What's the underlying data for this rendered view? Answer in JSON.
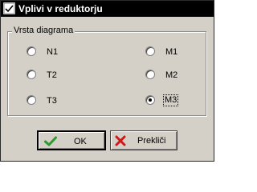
{
  "window": {
    "title": "Vplivi v reduktorju",
    "icon": "app-icon"
  },
  "group": {
    "label": "Vrsta diagrama",
    "options": [
      {
        "label": "N1",
        "checked": false
      },
      {
        "label": "T2",
        "checked": false
      },
      {
        "label": "T3",
        "checked": false
      },
      {
        "label": "M1",
        "checked": false
      },
      {
        "label": "M2",
        "checked": false
      },
      {
        "label": "M3",
        "checked": true
      }
    ]
  },
  "buttons": {
    "ok_label": "OK",
    "ok_icon": "check-icon",
    "cancel_label": "Prekliči",
    "cancel_icon": "x-icon"
  },
  "colors": {
    "check": "#2d9a2d",
    "cross": "#d01818",
    "face": "#d4d0c8"
  }
}
